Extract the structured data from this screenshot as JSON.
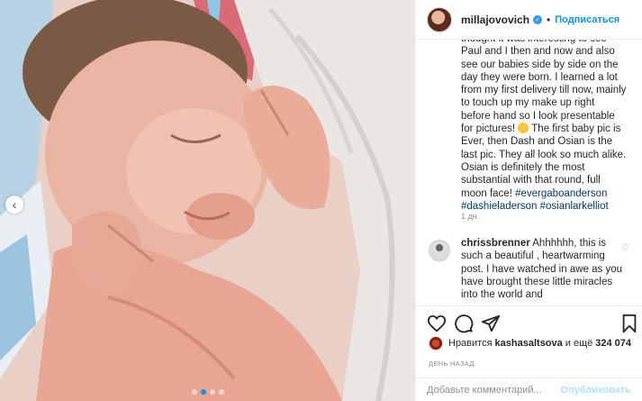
{
  "post": {
    "username": "millajovovich",
    "verified_mark": "✓",
    "separator": "•",
    "follow_label": "Подписаться",
    "caption_text": "thought it was interesting to see Paul and I then and now and also see our babies side by side on the day they were born. I learned a lot from my first delivery till now, mainly to touch up my make up right before hand so I look presentable for pictures!",
    "caption_text_2": "The first baby pic is Ever, then Dash and Osian is the last pic. They all look so much alike. Osian is definitely the most substantial with that round, full moon face!",
    "hashtags": "#evergaboanderson #dashieladerson #osianlarkelliot",
    "caption_time": "1 дн.",
    "comment": {
      "username": "chrissbrenner",
      "text": "Ahhhhhh, this is such a beautiful , heartwarming post. I have watched in awe as you have brought these little miracles into the world and"
    },
    "likes": {
      "prefix": "Нравится",
      "user": "kashasaltsova",
      "middle": "и ещё",
      "count": "324 074"
    },
    "day_ago": "ДЕНЬ НАЗАД",
    "add_comment_placeholder": "Добавьте комментарий...",
    "publish_label": "Опубликовать",
    "nav_prev": "‹"
  },
  "colors": {
    "accent": "#0095f6",
    "link": "#00376b",
    "muted": "#8e8e8e"
  },
  "icons": [
    "heart-icon",
    "comment-icon",
    "share-icon",
    "bookmark-icon",
    "verified-icon",
    "emoji-icon",
    "small-heart-icon"
  ]
}
